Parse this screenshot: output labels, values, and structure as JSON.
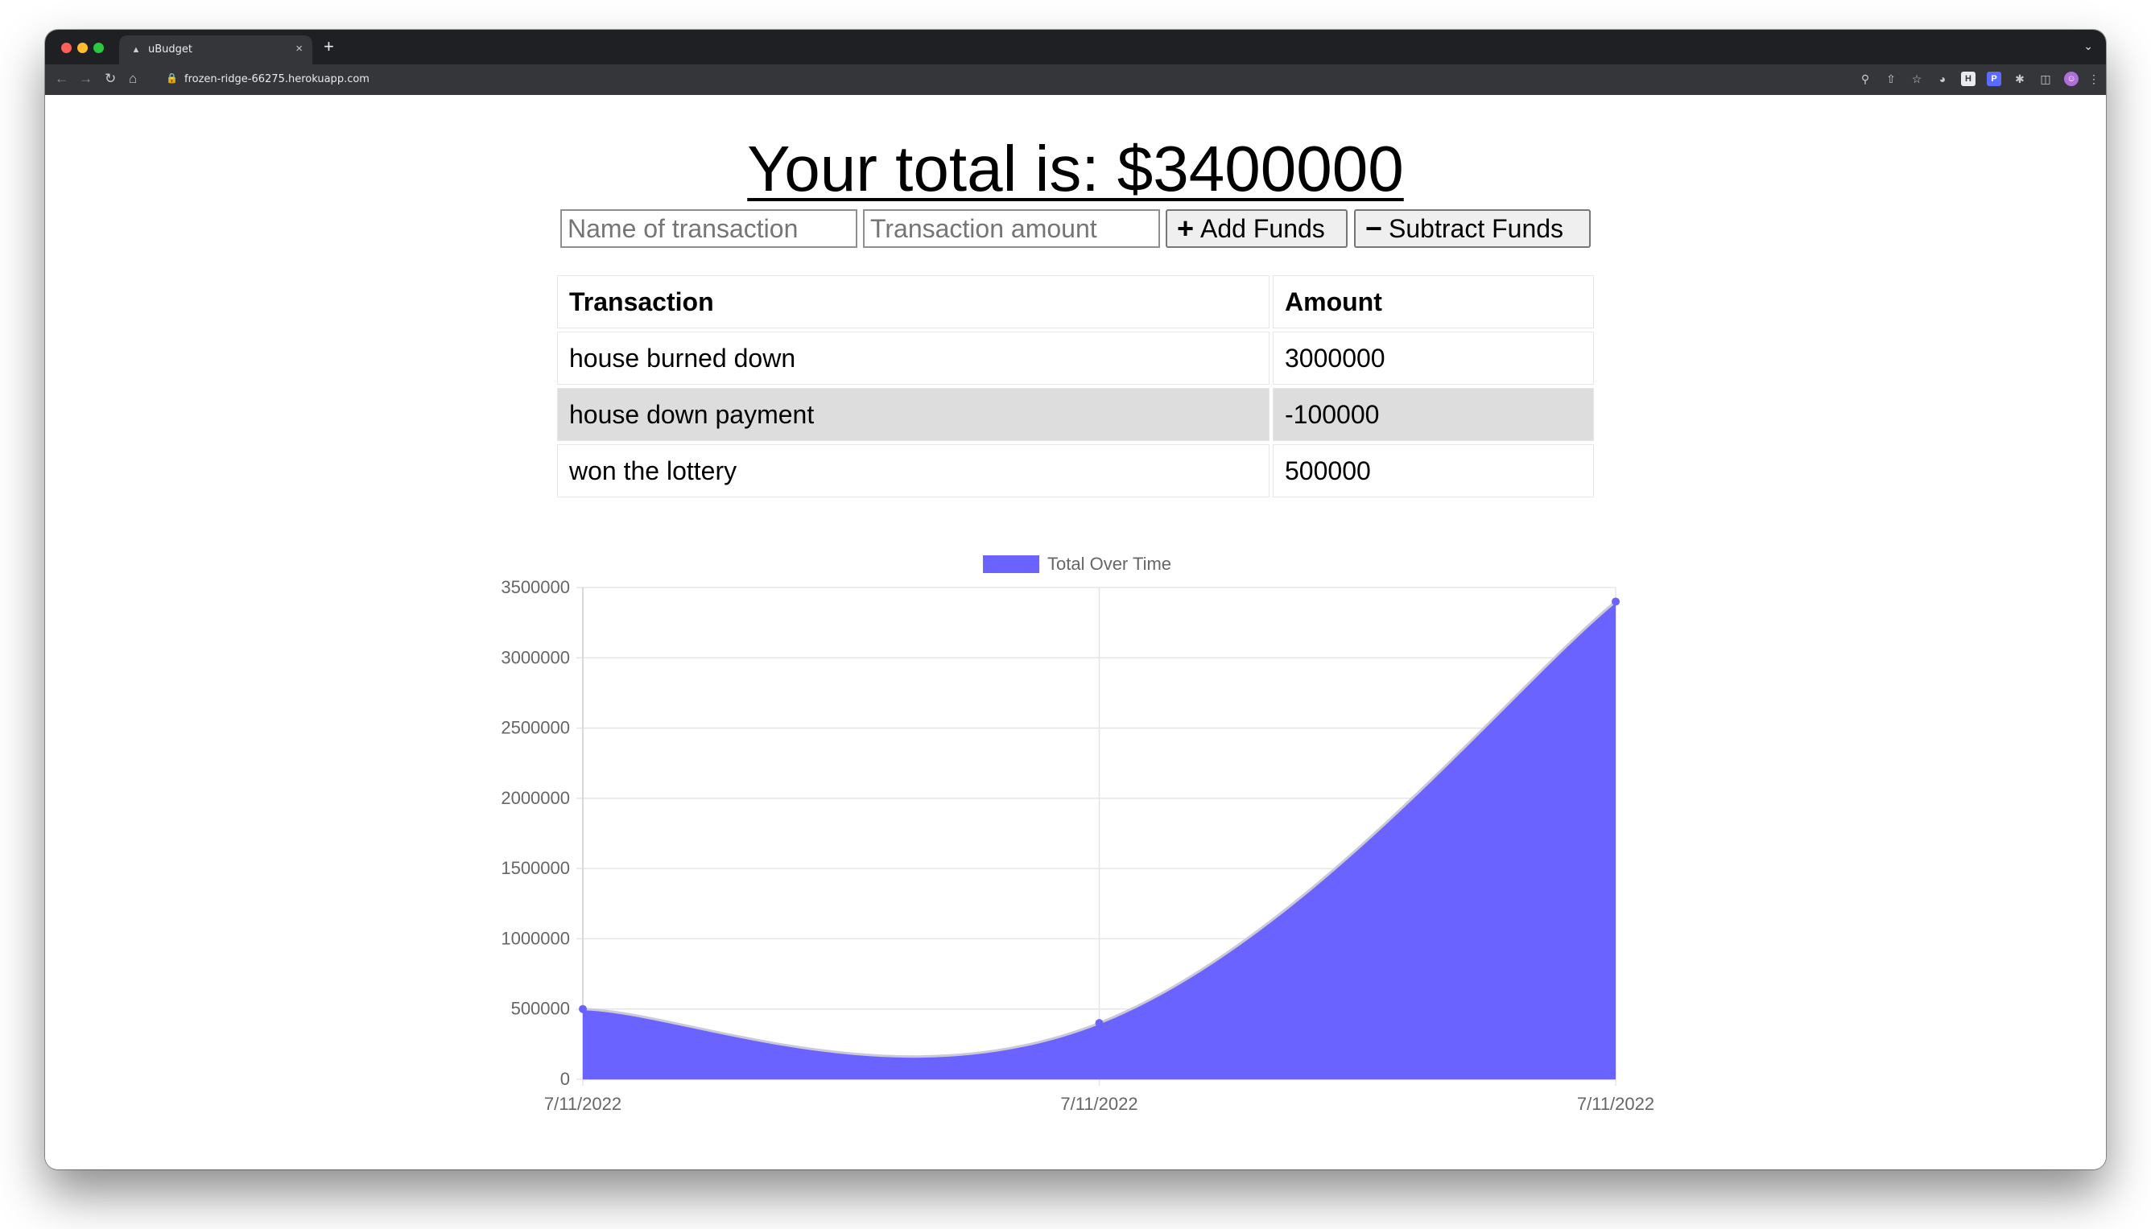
{
  "browser": {
    "tab_title": "uBudget",
    "tab_close": "×",
    "new_tab": "+",
    "url": "frozen-ridge-66275.herokuapp.com",
    "icons": [
      "back-arrow-icon",
      "forward-arrow-icon",
      "reload-icon",
      "home-icon",
      "lock-icon",
      "zoom-icon",
      "share-icon",
      "bookmark-star-icon",
      "extension-icon",
      "puzzle-icon",
      "sidebar-icon",
      "profile-avatar-icon",
      "kebab-menu-icon"
    ]
  },
  "page": {
    "total_heading": "Your total is: $3400000"
  },
  "form": {
    "name_placeholder": "Name of transaction",
    "amount_placeholder": "Transaction amount",
    "add_label": "Add Funds",
    "subtract_label": "Subtract Funds"
  },
  "table": {
    "headers": [
      "Transaction",
      "Amount"
    ],
    "rows": [
      {
        "name": "house burned down",
        "amount": "3000000"
      },
      {
        "name": "house down payment",
        "amount": "-100000"
      },
      {
        "name": "won the lottery",
        "amount": "500000"
      }
    ]
  },
  "chart_data": {
    "type": "area",
    "legend": "Total Over Time",
    "legend_position": "top",
    "x": [
      "7/11/2022",
      "7/11/2022",
      "7/11/2022"
    ],
    "values": [
      500000,
      400000,
      3400000
    ],
    "ylim": [
      0,
      3500000
    ],
    "yticks": [
      0,
      500000,
      1000000,
      1500000,
      2000000,
      2500000,
      3000000,
      3500000
    ],
    "grid": true,
    "color": "#6b63ff"
  }
}
